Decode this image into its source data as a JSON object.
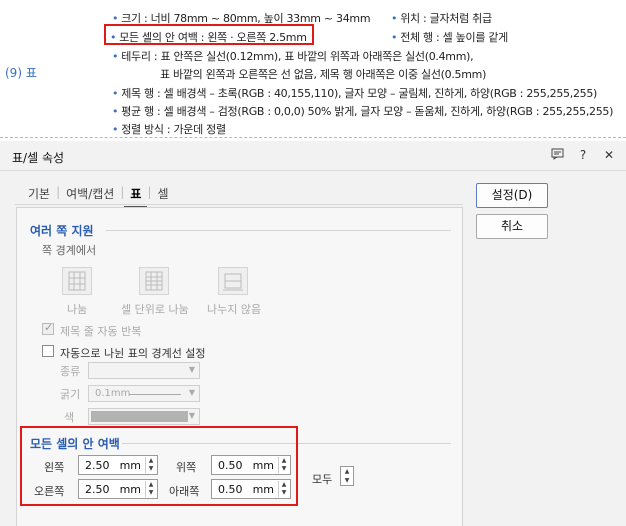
{
  "doc": {
    "section_number": "(9) 표",
    "lines": [
      {
        "text": "크기 : 너비 78mm ~ 80mm, 높이 33mm ~ 34mm"
      },
      {
        "text": "위치 : 글자처럼 취급"
      },
      {
        "text": "모든 셀의 안 여백 : 왼쪽 · 오른쪽 2.5mm"
      },
      {
        "text": "전체 행 : 셀 높이를 같게"
      },
      {
        "text": "테두리 : 표 안쪽은 실선(0.12mm), 표 바깥의 위쪽과 아래쪽은 실선(0.4mm),"
      },
      {
        "text": "표 바깥의 왼쪽과 오른쪽은 선 없음, 제목 행 아래쪽은 이중 실선(0.5mm)"
      },
      {
        "text": "제목 행 : 셀 배경색 – 초록(RGB : 40,155,110), 글자 모양 – 굴림체, 진하게, 하양(RGB : 255,255,255)"
      },
      {
        "text": "평균 행 : 셀 배경색 – 검정(RGB : 0,0,0) 50% 밝게, 글자 모양 – 돋움체, 진하게, 하양(RGB : 255,255,255)"
      },
      {
        "text": "정렬 방식 : 가운데 정렬"
      }
    ]
  },
  "dialog": {
    "title": "표/셀 속성",
    "title_icons": [
      "comment-icon",
      "help-icon",
      "close-icon"
    ],
    "tabs": [
      {
        "label": "기본",
        "active": false
      },
      {
        "label": "여백/캡션",
        "active": false
      },
      {
        "label": "표",
        "active": true
      },
      {
        "label": "셀",
        "active": false
      }
    ],
    "buttons": {
      "ok": "설정(D)",
      "cancel": "취소"
    },
    "multi_page": {
      "heading": "여러 쪽 지원",
      "boundary_label": "쪽 경계에서",
      "options": [
        "나눔",
        "셀 단위로 나눔",
        "나누지 않음"
      ],
      "repeat_title": "제목 줄 자동 반복",
      "auto_border": "자동으로 나뉜 표의 경계선 설정",
      "kind_label": "종류",
      "thickness_label": "굵기",
      "thickness_value": "0.1mm",
      "color_label": "색"
    },
    "cell_margin": {
      "heading": "모든 셀의 안 여백",
      "left_label": "왼쪽",
      "left_value": "2.50",
      "right_label": "오른쪽",
      "right_value": "2.50",
      "top_label": "위쪽",
      "top_value": "0.50",
      "bottom_label": "아래쪽",
      "bottom_value": "0.50",
      "unit": "mm",
      "all_label": "모두"
    },
    "colors": {
      "accent": "#2a5db0",
      "highlight": "#e01919",
      "bullet": "#3a70c6"
    }
  }
}
